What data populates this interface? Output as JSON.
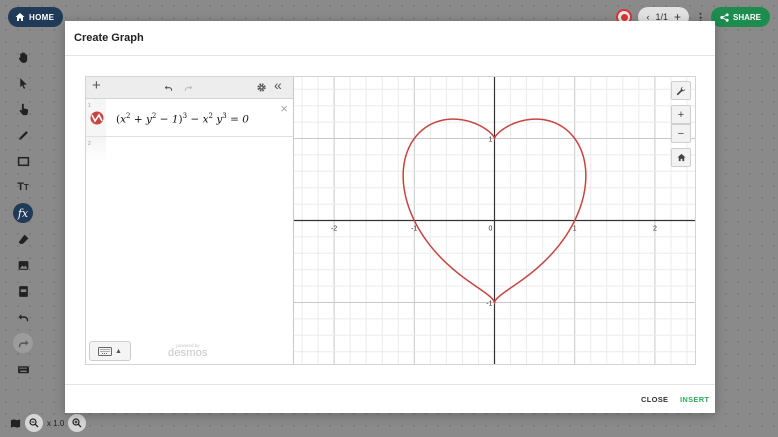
{
  "topbar": {
    "home_label": "HOME",
    "page_indicator": "1/1",
    "share_label": "SHARE"
  },
  "canvas": {
    "zoom_level": "x 1.0"
  },
  "modal": {
    "title": "Create Graph",
    "close_label": "CLOSE",
    "insert_label": "INSERT"
  },
  "desmos": {
    "expressions": [
      {
        "index": "1",
        "latex_display": "(x^2 + y^2 - 1)^3 - x^2 y^3 = 0",
        "color": "#c74440"
      },
      {
        "index": "2",
        "latex_display": ""
      }
    ],
    "branding_small": "powered by",
    "branding": "desmos",
    "axis": {
      "x_ticks": [
        "-2",
        "-1",
        "0",
        "1",
        "2"
      ],
      "y_ticks": [
        "1",
        "-1"
      ],
      "xlim": [
        -2.5,
        2.5
      ],
      "ylim": [
        -1.75,
        1.75
      ]
    }
  },
  "colors": {
    "accent_home": "#1f3b57",
    "share_green": "#1e8c4e",
    "insert_green": "#2eaa5c",
    "curve_red": "#c74440"
  }
}
